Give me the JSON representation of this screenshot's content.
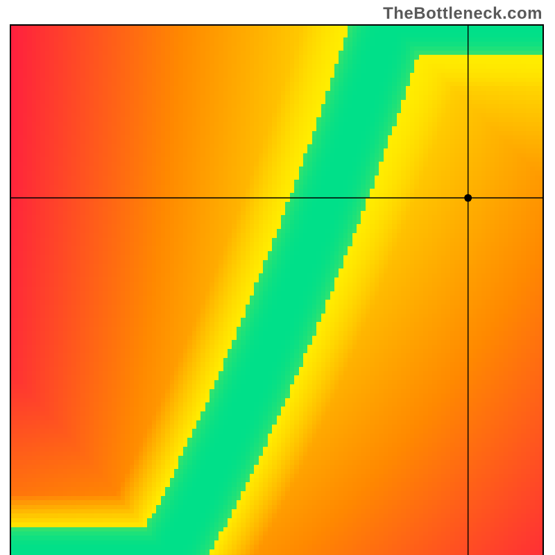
{
  "watermark": "TheBottleneck.com",
  "chart_data": {
    "type": "heatmap",
    "title": "",
    "xlabel": "",
    "ylabel": "",
    "xlim": [
      0,
      1
    ],
    "ylim": [
      0,
      1
    ],
    "marker": {
      "x": 0.858,
      "y": 0.675
    },
    "axes_visible": false,
    "description": "Red-yellow-green diagonal bottleneck heatmap with crosshair",
    "colors": {
      "red": "#ff1744",
      "orange": "#ff8a00",
      "yellow": "#ffee00",
      "green": "#00e08a"
    },
    "grid_resolution": 120,
    "canvas_size": 770,
    "curve": {
      "a": 1.5,
      "b": 0.9,
      "c": -0.4,
      "band_halfwidth": 0.055
    },
    "optimal_diagonal_samples": [
      {
        "x": 0.0,
        "y": 0.0
      },
      {
        "x": 0.1,
        "y": 0.055
      },
      {
        "x": 0.2,
        "y": 0.124
      },
      {
        "x": 0.3,
        "y": 0.207
      },
      {
        "x": 0.4,
        "y": 0.304
      },
      {
        "x": 0.5,
        "y": 0.415
      },
      {
        "x": 0.6,
        "y": 0.54
      },
      {
        "x": 0.7,
        "y": 0.679
      },
      {
        "x": 0.8,
        "y": 0.832
      },
      {
        "x": 0.9,
        "y": 0.999
      }
    ]
  }
}
